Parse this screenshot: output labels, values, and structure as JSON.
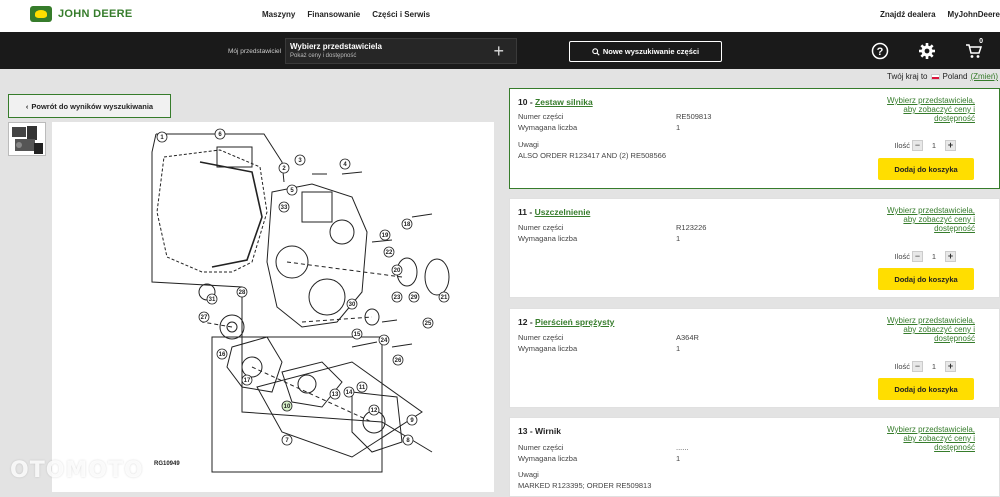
{
  "brand": {
    "name": "JOHN DEERE"
  },
  "nav": {
    "items": [
      "Maszyny",
      "Finansowanie",
      "Części i Serwis"
    ]
  },
  "right_nav": {
    "dealer": "Znajdź dealera",
    "account": "MyJohnDeere"
  },
  "dealer": {
    "label": "Mój przedstawiciel",
    "title": "Wybierz przedstawiciela",
    "subtitle": "Pokaż ceny i dostępność"
  },
  "search": {
    "new_search": "Nowe wyszukiwanie części"
  },
  "cart": {
    "count": "0"
  },
  "country": {
    "prefix": "Twój kraj to",
    "name": "Poland",
    "change": "(Zmień)"
  },
  "back": {
    "label": "Powrót do wyników wyszukiwania"
  },
  "diagram": {
    "code": "RG10949",
    "callouts": [
      "1",
      "2",
      "3",
      "4",
      "5",
      "6",
      "7",
      "8",
      "9",
      "10",
      "11",
      "12",
      "13",
      "14",
      "15",
      "16",
      "17",
      "18",
      "19",
      "20",
      "21",
      "22",
      "23",
      "24",
      "25",
      "26",
      "27",
      "28",
      "29",
      "30",
      "31",
      "33"
    ]
  },
  "parts": [
    {
      "num": "10",
      "name": "Zestaw silnika",
      "pn_label": "Numer części",
      "pn": "RE509813",
      "qty_label": "Wymagana liczba",
      "qty": "1",
      "notes_label": "Uwagi",
      "notes": "ALSO ORDER R123417 AND (2) RE508566",
      "dealer_link": "Wybierz przedstawiciela, aby zobaczyć ceny i dostępność",
      "qty_input_label": "Ilość",
      "qty_value": "1",
      "add_label": "Dodaj do koszyka"
    },
    {
      "num": "11",
      "name": "Uszczelnienie",
      "pn_label": "Numer części",
      "pn": "R123226",
      "qty_label": "Wymagana liczba",
      "qty": "1",
      "dealer_link": "Wybierz przedstawiciela, aby zobaczyć ceny i dostępność",
      "qty_input_label": "Ilość",
      "qty_value": "1",
      "add_label": "Dodaj do koszyka"
    },
    {
      "num": "12",
      "name": "Pierścień sprężysty",
      "pn_label": "Numer części",
      "pn": "A364R",
      "qty_label": "Wymagana liczba",
      "qty": "1",
      "dealer_link": "Wybierz przedstawiciela, aby zobaczyć ceny i dostępność",
      "qty_input_label": "Ilość",
      "qty_value": "1",
      "add_label": "Dodaj do koszyka"
    },
    {
      "num": "13",
      "name": "Wirnik",
      "pn_label": "Numer części",
      "pn": "......",
      "qty_label": "Wymagana liczba",
      "qty": "1",
      "notes_label": "Uwagi",
      "notes": "MARKED R123395; ORDER RE509813",
      "dealer_link": "Wybierz przedstawiciela, aby zobaczyć ceny i dostępność"
    }
  ],
  "watermark": "OTOMOTO"
}
